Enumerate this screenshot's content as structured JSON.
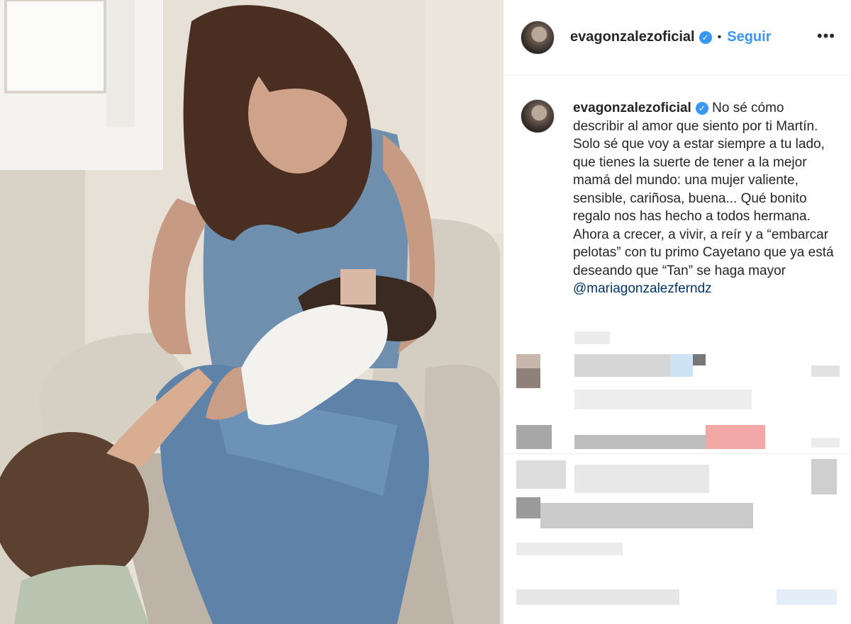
{
  "post": {
    "username": "evagonzalezoficial",
    "verified_icon": "verified-badge-icon",
    "separator": "•",
    "follow_label": "Seguir",
    "more_label": "•••"
  },
  "caption": {
    "username": "evagonzalezoficial",
    "text": "No sé cómo describir al amor que siento por ti Martín. Solo sé que voy a estar siempre a tu lado, que tienes la suerte de tener a la mejor mamá del mundo: una mujer valiente, sensible, cariñosa, buena... Qué bonito regalo nos has hecho a todos hermana. Ahora a crecer, a vivir, a reír y a “embarcar pelotas” con tu primo Cayetano que ya está deseando que “Tan” se haga mayor",
    "mention": "@mariagonzalezferndz"
  },
  "colors": {
    "accent": "#3897f0",
    "text": "#262626",
    "mention": "#003569",
    "divider": "#efefef"
  }
}
